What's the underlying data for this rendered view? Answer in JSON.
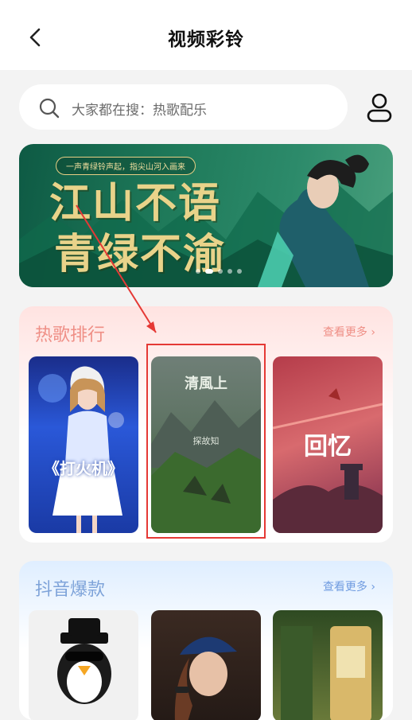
{
  "header": {
    "title": "视频彩铃",
    "back_icon": "chevron-left-icon"
  },
  "search": {
    "placeholder": "大家都在搜：热歌配乐",
    "icon": "search-icon"
  },
  "user_icon": "user-icon",
  "banner": {
    "tag": "一声青绿铃声起，指尖山河入画来",
    "line1": "江山不语",
    "line2": "青绿不渝",
    "slides_count": 5,
    "active_slide": 1
  },
  "hot_songs": {
    "title": "热歌排行",
    "more_label": "查看更多",
    "items": [
      {
        "label": "《打火机》"
      },
      {
        "label": "清風上",
        "sub": "探故知",
        "selected": true
      },
      {
        "label": "回忆"
      }
    ]
  },
  "douyin": {
    "title": "抖音爆款",
    "more_label": "查看更多"
  },
  "colors": {
    "hot_accent": "#ef8f86",
    "douyin_accent": "#6f9be0",
    "highlight": "#e53935"
  }
}
